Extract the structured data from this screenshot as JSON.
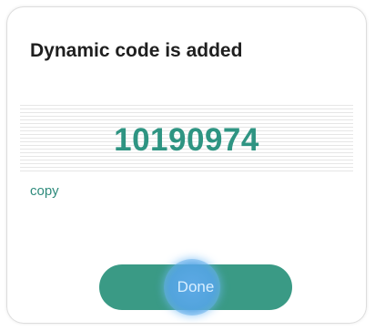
{
  "dialog": {
    "title": "Dynamic code is added",
    "code": "10190974",
    "copy_label": "copy",
    "done_label": "Done"
  },
  "colors": {
    "accent": "#2e9482",
    "button": "#3a9a85",
    "button_text": "#d9efff",
    "ripple": "#5aa8eb"
  }
}
